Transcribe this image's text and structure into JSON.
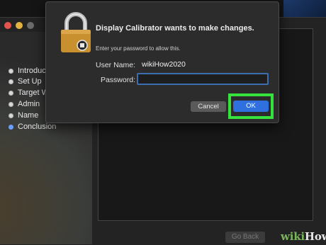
{
  "background_window": {
    "steps": [
      {
        "label": "Introduction",
        "active": false
      },
      {
        "label": "Set Up",
        "active": false
      },
      {
        "label": "Target White Point",
        "active": false
      },
      {
        "label": "Admin",
        "active": false
      },
      {
        "label": "Name",
        "active": false
      },
      {
        "label": "Conclusion",
        "active": true
      }
    ],
    "go_back_label": "Go Back"
  },
  "dialog": {
    "title": "Display Calibrator wants to make changes.",
    "message": "Enter your password to allow this.",
    "username_label": "User Name:",
    "username_value": "wikiHow2020",
    "password_label": "Password:",
    "password_value": "",
    "cancel_label": "Cancel",
    "ok_label": "OK",
    "icon": "lock-icon"
  },
  "watermark": {
    "prefix": "wiki",
    "suffix": "How"
  },
  "colors": {
    "ok_button": "#2f6fde",
    "highlight": "#36e23c",
    "focus_ring": "#3d6eb2",
    "active_step_dot": "#6aa0ff"
  }
}
